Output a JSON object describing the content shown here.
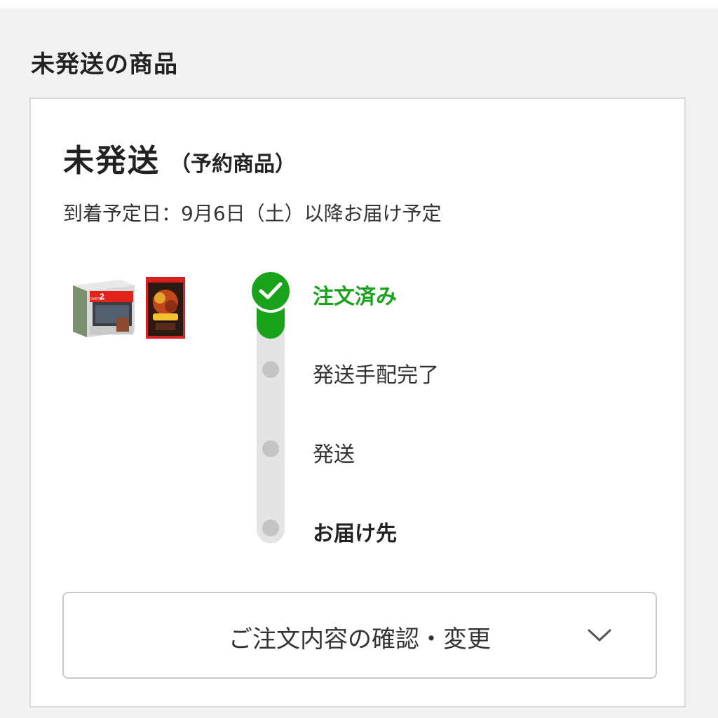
{
  "section": {
    "title": "未発送の商品"
  },
  "order": {
    "status_main": "未発送",
    "status_sub": "（予約商品）",
    "arrival_text": "到着予定日：9月6日（土）以降お届け予定",
    "products": [
      {
        "icon": "console-box-image",
        "box_text": "2",
        "brand": "SWITCH"
      },
      {
        "icon": "game-package-image"
      }
    ]
  },
  "progress": {
    "steps": [
      {
        "label": "注文済み",
        "state": "completed"
      },
      {
        "label": "発送手配完了",
        "state": "pending"
      },
      {
        "label": "発送",
        "state": "pending"
      },
      {
        "label": "お届け先",
        "state": "pending"
      }
    ],
    "completed_color": "#1aa21a",
    "pending_color": "#c4c4c4"
  },
  "actions": {
    "confirm_change_label": "ご注文内容の確認・変更",
    "confirm_change_icon": "chevron-down-icon"
  }
}
